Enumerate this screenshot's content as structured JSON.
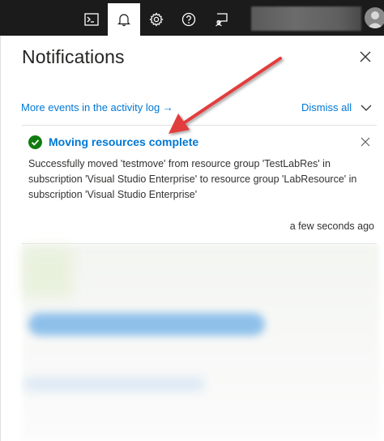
{
  "topbar": {
    "icons": [
      {
        "name": "cloud-shell-icon",
        "active": false
      },
      {
        "name": "bell-icon",
        "active": true
      },
      {
        "name": "gear-icon",
        "active": false
      },
      {
        "name": "help-icon",
        "active": false
      },
      {
        "name": "feedback-icon",
        "active": false
      }
    ]
  },
  "panel": {
    "title": "Notifications",
    "activity_log_link": "More events in the activity log",
    "activity_log_arrow": "→",
    "dismiss_all": "Dismiss all"
  },
  "notification": {
    "title": "Moving resources complete",
    "body": "Successfully moved 'testmove' from resource group 'TestLabRes' in subscription 'Visual Studio Enterprise' to resource group 'LabResource' in subscription 'Visual Studio Enterprise'",
    "time": "a few seconds ago",
    "status_color": "#107c10"
  },
  "colors": {
    "accent": "#0078d4",
    "topbar_bg": "#1b1b1b",
    "annotation_arrow": "#e23c3c"
  }
}
